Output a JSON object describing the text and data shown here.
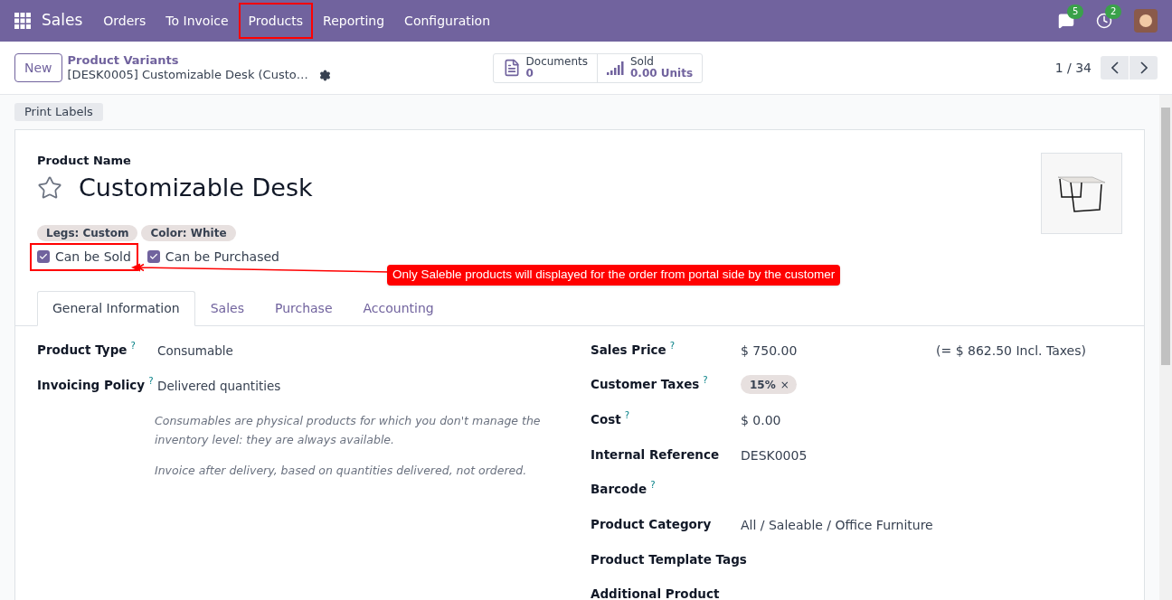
{
  "navbar": {
    "app": "Sales",
    "menu": [
      {
        "label": "Orders",
        "highlighted": false
      },
      {
        "label": "To Invoice",
        "highlighted": false
      },
      {
        "label": "Products",
        "highlighted": true
      },
      {
        "label": "Reporting",
        "highlighted": false
      },
      {
        "label": "Configuration",
        "highlighted": false
      }
    ],
    "messages_count": "5",
    "activities_count": "2"
  },
  "control_panel": {
    "new_button": "New",
    "breadcrumb": "Product Variants",
    "record_title": "[DESK0005] Customizable Desk (Custo…",
    "smart_buttons": [
      {
        "kind": "documents",
        "label": "Documents",
        "value": "0"
      },
      {
        "kind": "sold",
        "label": "Sold",
        "value": "0.00 Units"
      }
    ],
    "pager": "1 / 34"
  },
  "action_button": "Print Labels",
  "form": {
    "name_label": "Product Name",
    "name": "Customizable Desk",
    "favorite": false,
    "attributes": [
      "Legs: Custom",
      "Color: White"
    ],
    "checkboxes": [
      {
        "label": "Can be Sold",
        "checked": true,
        "highlighted": true
      },
      {
        "label": "Can be Purchased",
        "checked": true,
        "highlighted": false
      }
    ],
    "callout": "Only Saleble products will displayed for the order from portal side by the customer",
    "tabs": [
      {
        "label": "General Information",
        "selected": true
      },
      {
        "label": "Sales",
        "selected": false
      },
      {
        "label": "Purchase",
        "selected": false
      },
      {
        "label": "Accounting",
        "selected": false
      }
    ],
    "left_fields": [
      {
        "label": "Product Type",
        "help": "?",
        "value": "Consumable"
      },
      {
        "label": "Invoicing Policy",
        "help": "?",
        "value": "Delivered quantities"
      }
    ],
    "notes": [
      "Consumables are physical products for which you don't manage the inventory level: they are always available.",
      "Invoice after delivery, based on quantities delivered, not ordered."
    ],
    "right_fields": [
      {
        "label": "Sales Price",
        "help": "?",
        "kind": "text",
        "value": "$ 750.00",
        "extra": "(= $ 862.50 Incl. Taxes)"
      },
      {
        "label": "Customer Taxes",
        "help": "?",
        "kind": "tags",
        "tags": [
          "15%"
        ],
        "remove": "×"
      },
      {
        "label": "Cost",
        "help": "?",
        "kind": "text",
        "value": "$ 0.00"
      },
      {
        "label": "Internal Reference",
        "kind": "text",
        "value": "DESK0005"
      },
      {
        "label": "Barcode",
        "help": "?",
        "kind": "text"
      },
      {
        "label": "Product Category",
        "kind": "text",
        "value": "All / Saleable / Office Furniture"
      },
      {
        "label": "Product Template Tags",
        "kind": "text"
      },
      {
        "label": "Additional Product",
        "kind": "text"
      }
    ]
  }
}
